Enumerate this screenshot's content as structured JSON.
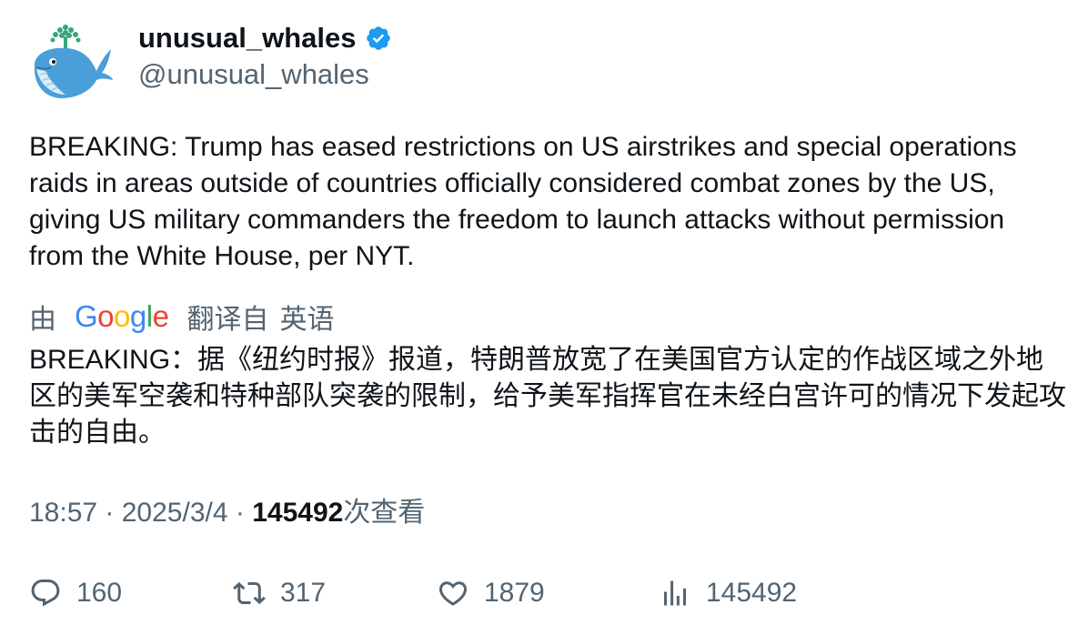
{
  "author": {
    "display_name": "unusual_whales",
    "handle": "@unusual_whales",
    "verified": true,
    "avatar_icon": "whale-icon"
  },
  "tweet": {
    "text": "BREAKING: Trump has eased restrictions on US airstrikes and special operations raids in areas outside of countries officially considered combat zones by the US, giving US military commanders the freedom to launch attacks without permission from the White House, per NYT."
  },
  "translation": {
    "prefix": "由",
    "provider": "Google",
    "suffix": "翻译自",
    "source_language": "英语",
    "text": "BREAKING：据《纽约时报》报道，特朗普放宽了在美国官方认定的作战区域之外地区的美军空袭和特种部队突袭的限制，给予美军指挥官在未经白宫许可的情况下发起攻击的自由。"
  },
  "meta": {
    "time": "18:57",
    "separator": " · ",
    "date": "2025/3/4",
    "views_count": "145492",
    "views_label": "次查看"
  },
  "actions": {
    "replies": "160",
    "retweets": "317",
    "likes": "1879",
    "views": "145492"
  },
  "colors": {
    "text_primary": "#0f1419",
    "text_secondary": "#536471",
    "verified_badge": "#1d9bf0",
    "whale_body": "#4a9fd8"
  }
}
